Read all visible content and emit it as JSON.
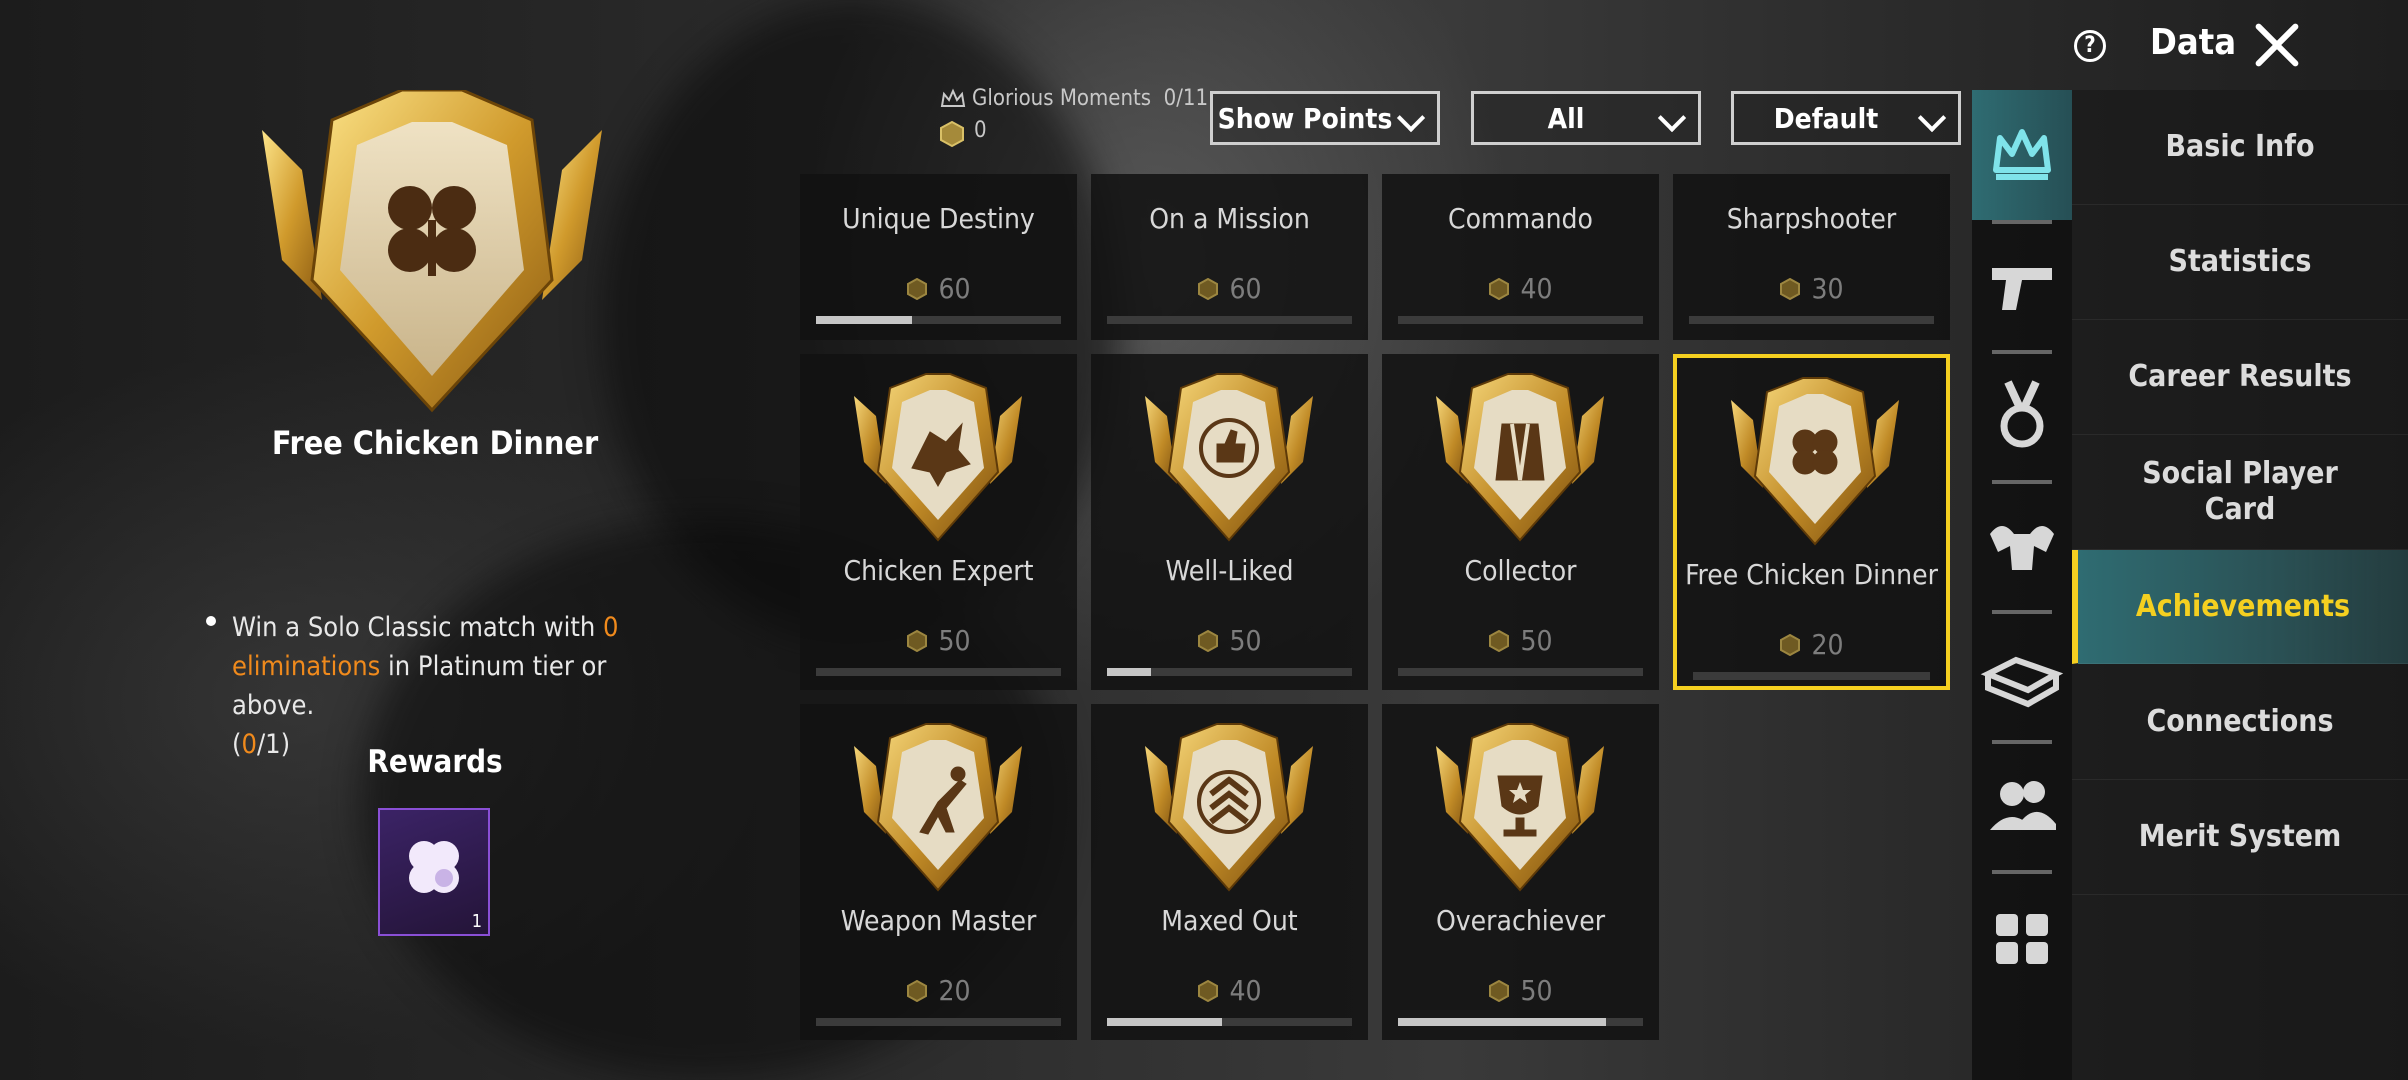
{
  "header": {
    "title": "Data",
    "help_icon": "help-icon",
    "close_icon": "close-icon"
  },
  "selected_achievement": {
    "name": "Free Chicken Dinner",
    "description_parts": [
      "Win a Solo Classic match with ",
      "0 eliminations",
      " in Platinum tier or above."
    ],
    "progress_open": "(",
    "progress_current": "0",
    "progress_rest": "/1)",
    "rewards_label": "Rewards",
    "reward_count": "1"
  },
  "filters": {
    "glorious_label": "Glorious Moments",
    "glorious_count": "0/11",
    "points_total": "0",
    "show_points": "Show Points",
    "category": "All",
    "sort": "Default"
  },
  "achievements": [
    {
      "name": "Unique Destiny",
      "points": "60",
      "progress": 0.39,
      "badge": "none"
    },
    {
      "name": "On a Mission",
      "points": "60",
      "progress": 0.0,
      "badge": "none"
    },
    {
      "name": "Commando",
      "points": "40",
      "progress": 0.0,
      "badge": "none"
    },
    {
      "name": "Sharpshooter",
      "points": "30",
      "progress": 0.0,
      "badge": "none"
    },
    {
      "name": "Chicken Expert",
      "points": "50",
      "progress": 0.0,
      "badge": "chicken-icon"
    },
    {
      "name": "Well-Liked",
      "points": "50",
      "progress": 0.18,
      "badge": "thumbs-up-icon"
    },
    {
      "name": "Collector",
      "points": "50",
      "progress": 0.0,
      "badge": "armor-icon"
    },
    {
      "name": "Free Chicken Dinner",
      "points": "20",
      "progress": 0.0,
      "badge": "clover-icon"
    },
    {
      "name": "Weapon Master",
      "points": "20",
      "progress": 0.0,
      "badge": "diving-figure-icon"
    },
    {
      "name": "Maxed Out",
      "points": "40",
      "progress": 0.47,
      "badge": "rank-chevron-icon"
    },
    {
      "name": "Overachiever",
      "points": "50",
      "progress": 0.85,
      "badge": "trophy-icon"
    }
  ],
  "side_tabs": [
    "crown-icon",
    "pistol-icon",
    "medal-icon",
    "flexing-arm-icon",
    "crate-icon",
    "friends-icon",
    "grid-icon"
  ],
  "menu": {
    "items": [
      "Basic Info",
      "Statistics",
      "Career Results",
      "Social Player Card",
      "Achievements",
      "Connections",
      "Merit System"
    ],
    "active": "Achievements"
  },
  "colors": {
    "accent_gold": "#f5d020",
    "accent_teal": "#2f6c72",
    "highlight_orange": "#f08a1c",
    "reward_purple": "#8a4fd6"
  }
}
